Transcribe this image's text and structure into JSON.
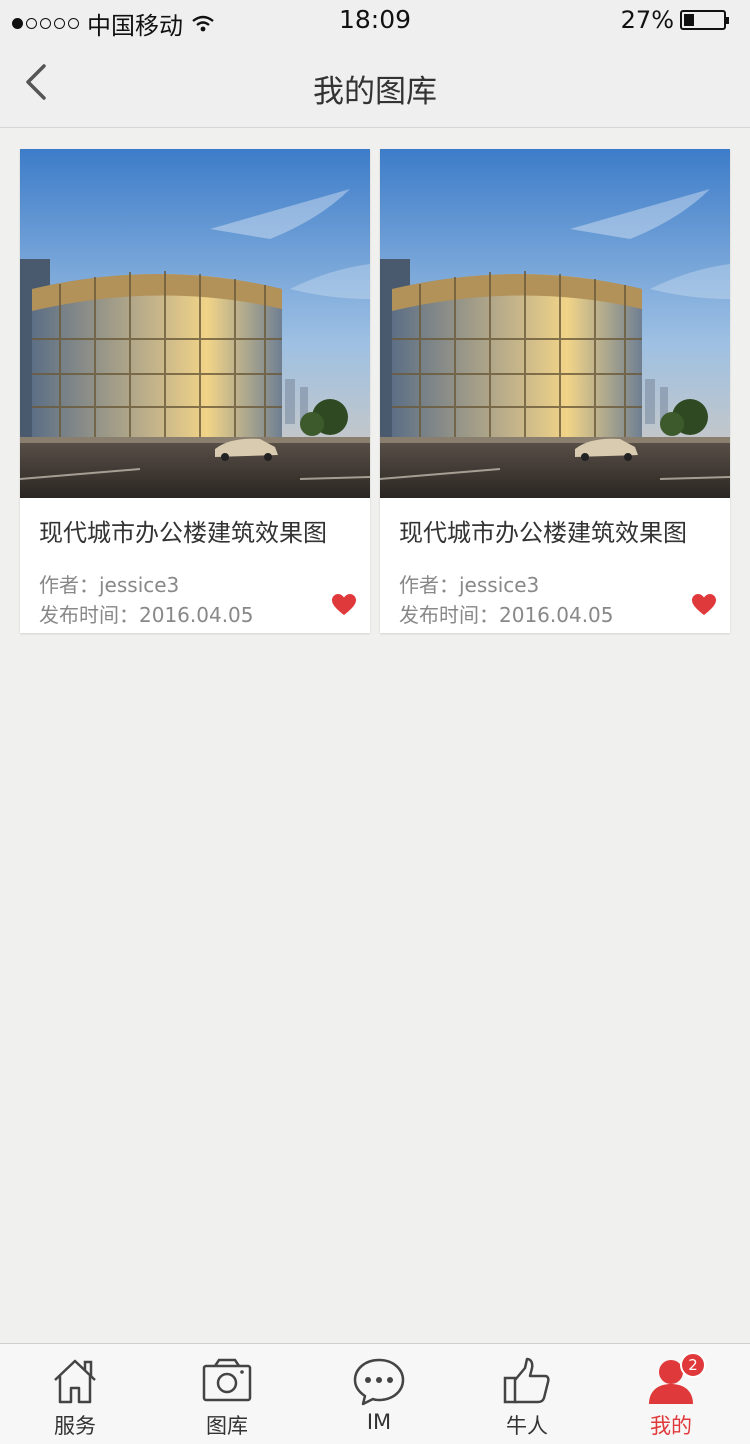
{
  "status_bar": {
    "carrier": "中国移动",
    "time": "18:09",
    "battery": "27%",
    "battery_level": 0.27,
    "signal_bars": 1
  },
  "header": {
    "title": "我的图库",
    "back_icon": "chevron-left-icon"
  },
  "gallery": [
    {
      "title": "现代城市办公楼建筑效果图",
      "author": "作者：jessice3",
      "date": "发布时间：2016.04.05",
      "favorited": true
    },
    {
      "title": "现代城市办公楼建筑效果图",
      "author": "作者：jessice3",
      "date": "发布时间：2016.04.05",
      "favorited": true
    }
  ],
  "tabs": [
    {
      "label": "服务",
      "icon": "home-icon",
      "active": false
    },
    {
      "label": "图库",
      "icon": "camera-icon",
      "active": false
    },
    {
      "label": "IM",
      "icon": "chat-icon",
      "active": false
    },
    {
      "label": "牛人",
      "icon": "thumbs-up-icon",
      "active": false
    },
    {
      "label": "我的",
      "icon": "user-icon",
      "active": true,
      "badge": "2"
    }
  ],
  "colors": {
    "accent": "#e0393b",
    "background": "#f0f0ee",
    "bar": "#efefef"
  }
}
